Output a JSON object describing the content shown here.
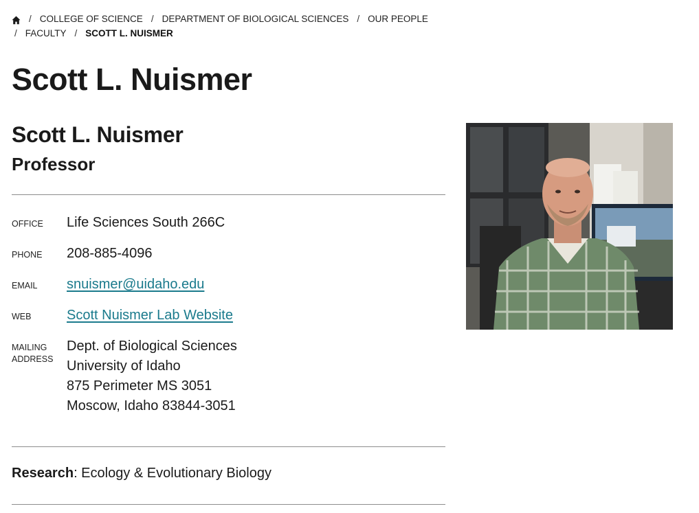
{
  "breadcrumb": {
    "items": [
      "College of Science",
      "Department of Biological Sciences",
      "Our People",
      "Faculty"
    ],
    "current": "Scott L. Nuismer"
  },
  "page": {
    "title": "Scott L. Nuismer"
  },
  "profile": {
    "name": "Scott L. Nuismer",
    "title": "Professor"
  },
  "contact": {
    "office_label": "Office",
    "office": "Life Sciences South 266C",
    "phone_label": "Phone",
    "phone": "208-885-4096",
    "email_label": "Email",
    "email": "snuismer@uidaho.edu",
    "web_label": "Web",
    "web": "Scott Nuismer Lab Website",
    "mailing_label": "Mailing Address",
    "address": [
      "Dept. of Biological Sciences",
      "University of Idaho",
      "875 Perimeter MS 3051",
      "Moscow, Idaho 83844-3051"
    ]
  },
  "research": {
    "label": "Research",
    "value": ": Ecology & Evolutionary Biology"
  },
  "colors": {
    "link": "#1a7a8c",
    "text": "#1a1a1a",
    "rule": "#8c8c8c"
  }
}
